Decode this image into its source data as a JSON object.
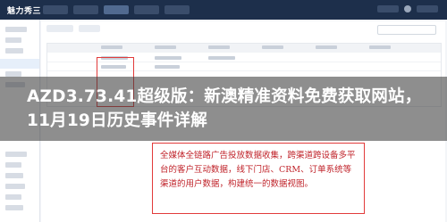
{
  "app": {
    "logo_text": "魅力秀三"
  },
  "headline": {
    "text": "AZD3.73.41超级版：新澳精准资料免费获取网站，11月19日历史事件详解"
  },
  "annotation": {
    "text": "全媒体全链路广告投放数据收集，跨渠道跨设备多平台的客户互动数据，线下门店、CRM、订单系统等渠道的用户数据，构建统一的数据视图。"
  },
  "colors": {
    "topbar": "#1d2f4b",
    "annotation_red": "#e23b3b",
    "banner_overlay": "rgba(60,60,60,0.58)"
  }
}
